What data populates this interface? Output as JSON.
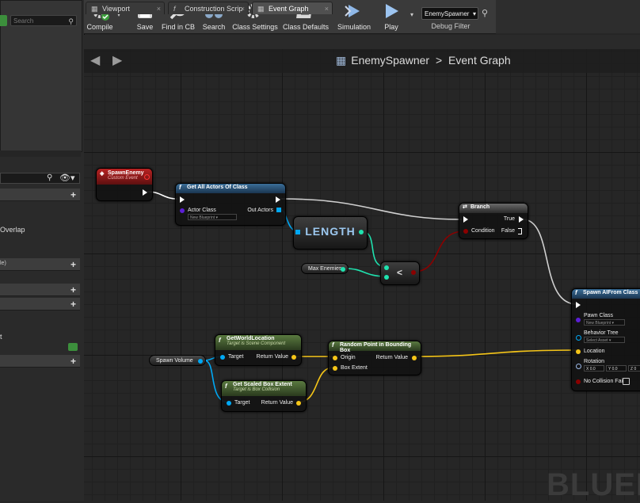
{
  "toolbar": {
    "compile": "Compile",
    "save": "Save",
    "find_in_cb": "Find in CB",
    "search": "Search",
    "class_settings": "Class Settings",
    "class_defaults": "Class Defaults",
    "simulation": "Simulation",
    "play": "Play",
    "debug_object": "EnemySpawner",
    "debug_filter": "Debug Filter"
  },
  "left_panel": {
    "search_placeholder": "Search",
    "overlap_label": "Overlap",
    "le_label": "le)",
    "t_label": "t"
  },
  "tabs": [
    {
      "label": "Viewport"
    },
    {
      "label": "Construction Scrip"
    },
    {
      "label": "Event Graph"
    }
  ],
  "breadcrumb": {
    "blueprint": "EnemySpawner",
    "separator": ">",
    "graph": "Event Graph"
  },
  "watermark": "BLUEP",
  "nodes": {
    "spawn_enemy": {
      "title": "SpawnEnemy",
      "subtitle": "Custom Event"
    },
    "get_all_actors": {
      "title": "Get All Actors Of Class",
      "actor_class": "Actor Class",
      "actor_class_value": "New Blueprint",
      "out_actors": "Out Actors"
    },
    "length": {
      "title": "LENGTH"
    },
    "max_enemies": {
      "label": "Max Enemies"
    },
    "less_than": {
      "symbol": "<"
    },
    "branch": {
      "title": "Branch",
      "condition": "Condition",
      "true": "True",
      "false": "False"
    },
    "spawn_ai": {
      "title": "Spawn AIFrom Class",
      "pawn_class": "Pawn Class",
      "pawn_class_value": "New Blueprint",
      "behavior_tree": "Behavior Tree",
      "behavior_tree_value": "Select Asset",
      "location": "Location",
      "rotation": "Rotation",
      "rot_x": "0.0",
      "rot_y": "0.0",
      "rot_z": "0",
      "no_collision_fail": "No Collision Fail"
    },
    "get_world_location": {
      "title": "GetWorldLocation",
      "subtitle": "Target is Scene Component",
      "target": "Target",
      "return_value": "Return Value"
    },
    "get_scaled_box_extent": {
      "title": "Get Scaled Box Extent",
      "subtitle": "Target is Box Collision",
      "target": "Target",
      "return_value": "Return Value"
    },
    "random_point": {
      "title": "Random Point in Bounding Box",
      "origin": "Origin",
      "box_extent": "Box Extent",
      "return_value": "Return Value"
    },
    "spawn_volume": {
      "label": "Spawn Volume"
    }
  },
  "colors": {
    "exec": "#ffffff",
    "object": "#00a8f4",
    "vector": "#f5c518",
    "boolean": "#8b0000",
    "integer": "#1fe3af",
    "class": "#5c1fd6"
  }
}
